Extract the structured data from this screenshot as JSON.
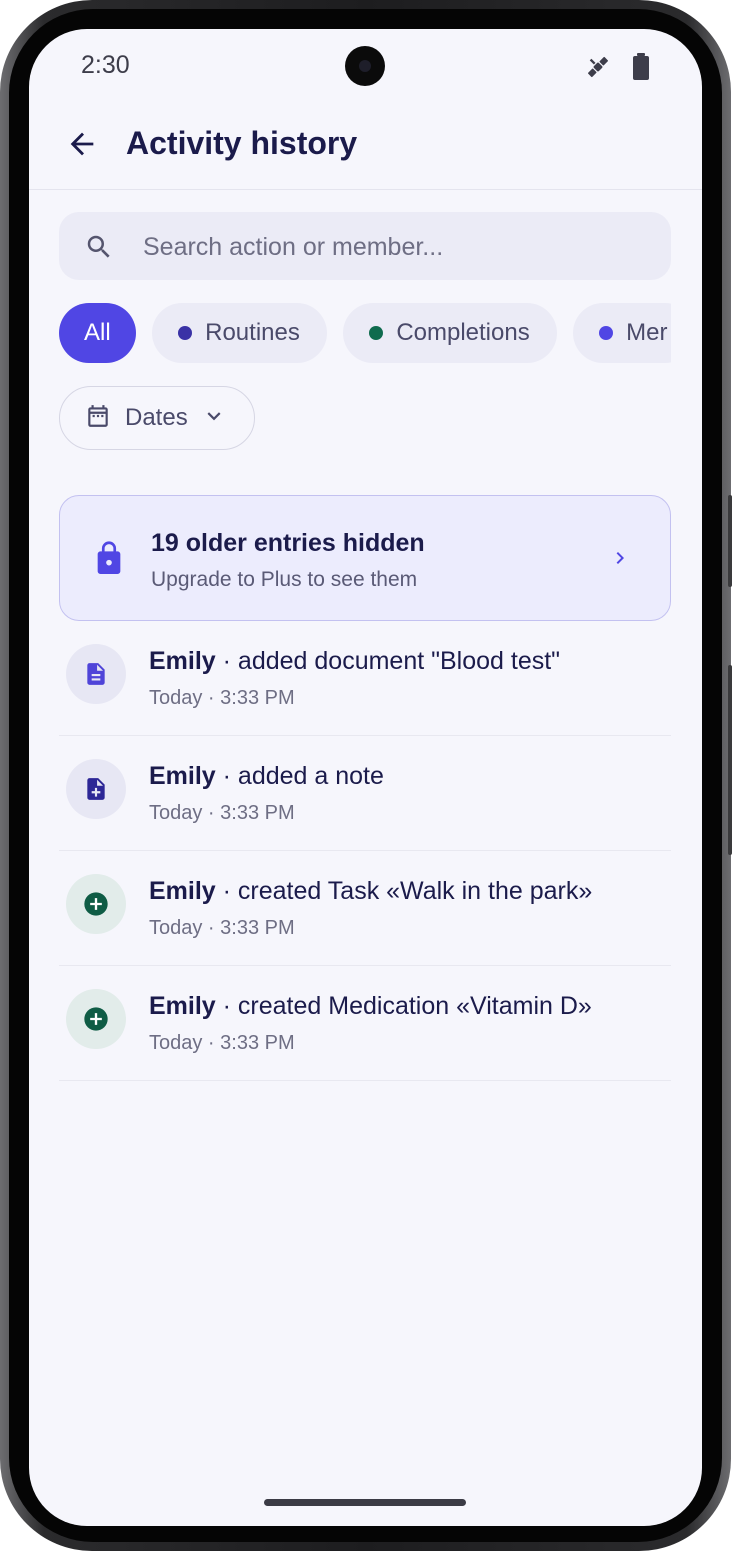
{
  "status_bar": {
    "time": "2:30",
    "icons": [
      "satellite-icon",
      "battery-icon"
    ]
  },
  "header": {
    "back_icon": "arrow-back-icon",
    "title": "Activity history"
  },
  "search": {
    "placeholder": "Search action or member...",
    "value": "",
    "icon": "search-icon"
  },
  "filters": {
    "chips": [
      {
        "label": "All",
        "active": true
      },
      {
        "label": "Routines",
        "dot_color": "#3a32a6",
        "active": false
      },
      {
        "label": "Completions",
        "dot_color": "#0f6b4e",
        "active": false
      },
      {
        "label": "Mer",
        "dot_color": "#5046e4",
        "active": false
      }
    ],
    "dates": {
      "label": "Dates",
      "icon": "calendar-icon",
      "chevron": "chevron-down-icon"
    }
  },
  "upgrade_banner": {
    "title": "19 older entries hidden",
    "subtitle": "Upgrade to Plus to see them",
    "icon": "lock-icon",
    "chevron": "chevron-right-icon"
  },
  "activities": [
    {
      "member": "Emily",
      "action": " · added document \"Blood test\"",
      "time": "Today · 3:33 PM",
      "icon": "document-icon"
    },
    {
      "member": "Emily",
      "action": " · added a note",
      "time": "Today · 3:33 PM",
      "icon": "note-add-icon"
    },
    {
      "member": "Emily",
      "action": " · created Task «Walk in the park»",
      "time": "Today · 3:33 PM",
      "icon": "add-circle-icon"
    },
    {
      "member": "Emily",
      "action": " · created Medication «Vitamin D»",
      "time": "Today · 3:33 PM",
      "icon": "add-circle-icon"
    }
  ],
  "colors": {
    "accent": "#5046e4",
    "title": "#1b1b4b",
    "background": "#f6f6fc",
    "create_green": "#0f5c45"
  }
}
